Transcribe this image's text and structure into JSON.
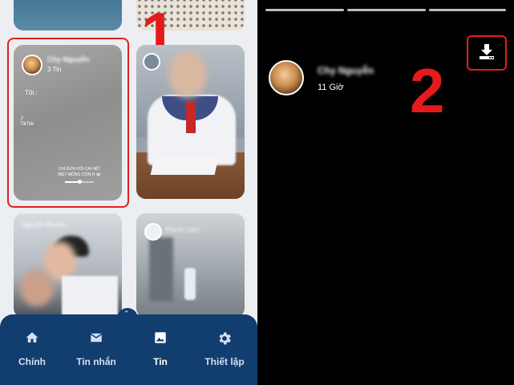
{
  "left_screen": {
    "story_card": {
      "name": "Chy Nguyễn",
      "count": "3 Tin",
      "text": "Tôi :",
      "tiktok_label": "TikTok",
      "caption": "CHỈ ĐỨA HỞI CÁI HẾT BIỆT MỒNG CỢN H 😂",
      "progress": 0.5
    },
    "annotation_number": "1",
    "class_card_caption": "Nguyễn Phước...",
    "room_card_caption": "Phước Lâm...",
    "nav": {
      "up_arrow": "⌃",
      "items": [
        {
          "label": "Chính",
          "icon": "home-icon"
        },
        {
          "label": "Tin nhắn",
          "icon": "mail-icon"
        },
        {
          "label": "Tin",
          "icon": "image-icon"
        },
        {
          "label": "Thiết lập",
          "icon": "gear-icon"
        }
      ],
      "active": "Tin"
    },
    "colors": {
      "nav_background": "#113d6f",
      "highlight": "#e02020"
    }
  },
  "right_screen": {
    "user_name": "Chy Nguyễn",
    "time": "11 Giờ",
    "annotation_number": "2",
    "download_icon": "download-icon"
  }
}
